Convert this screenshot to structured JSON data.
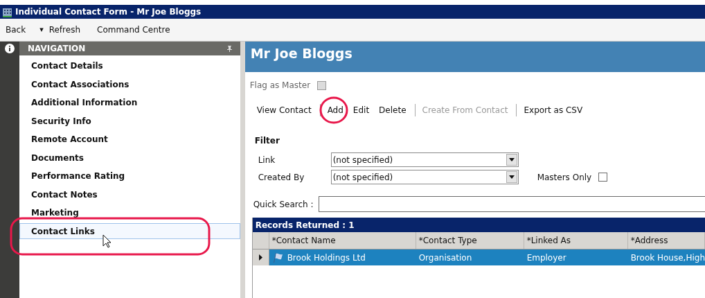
{
  "window": {
    "title": "Individual Contact Form - Mr Joe Bloggs"
  },
  "toolbar": [
    {
      "label": "Back",
      "kind": "button"
    },
    {
      "label": "▾",
      "kind": "dropdown"
    },
    {
      "label": "Refresh",
      "kind": "button"
    },
    {
      "label": "Command Centre",
      "kind": "button"
    }
  ],
  "navigation": {
    "title": "NAVIGATION",
    "items": [
      {
        "label": "Contact Details",
        "selected": false
      },
      {
        "label": "Contact Associations",
        "selected": false
      },
      {
        "label": "Additional Information",
        "selected": false
      },
      {
        "label": "Security Info",
        "selected": false
      },
      {
        "label": "Remote Account",
        "selected": false
      },
      {
        "label": "Documents",
        "selected": false
      },
      {
        "label": "Performance Rating",
        "selected": false
      },
      {
        "label": "Contact Notes",
        "selected": false
      },
      {
        "label": "Marketing",
        "selected": false
      },
      {
        "label": "Contact Links",
        "selected": true
      }
    ]
  },
  "header": {
    "title": "Mr Joe Bloggs"
  },
  "flag_as_master": {
    "label": "Flag as Master",
    "checked": false,
    "disabled": true
  },
  "actions": [
    {
      "label": "View Contact",
      "disabled": false,
      "separator_after": true
    },
    {
      "label": "Add",
      "disabled": false,
      "separator_after": false
    },
    {
      "label": "Edit",
      "disabled": false,
      "separator_after": false
    },
    {
      "label": "Delete",
      "disabled": false,
      "separator_after": true
    },
    {
      "label": "Create From Contact",
      "disabled": true,
      "separator_after": true
    },
    {
      "label": "Export as CSV",
      "disabled": false,
      "separator_after": false
    }
  ],
  "filter": {
    "title": "Filter",
    "link": {
      "label": "Link",
      "value": "(not specified)"
    },
    "created_by": {
      "label": "Created By",
      "value": "(not specified)"
    },
    "masters_only": {
      "label": "Masters Only",
      "checked": false
    }
  },
  "quick_search": {
    "label": "Quick Search :"
  },
  "records": {
    "title": "Records Returned : 1",
    "columns": [
      "*Contact Name",
      "*Contact Type",
      "*Linked As",
      "*Address"
    ],
    "rows": [
      {
        "cells": [
          "Brook Holdings Ltd",
          "Organisation",
          "Employer",
          "Brook House,High"
        ],
        "selected": true
      }
    ]
  }
}
